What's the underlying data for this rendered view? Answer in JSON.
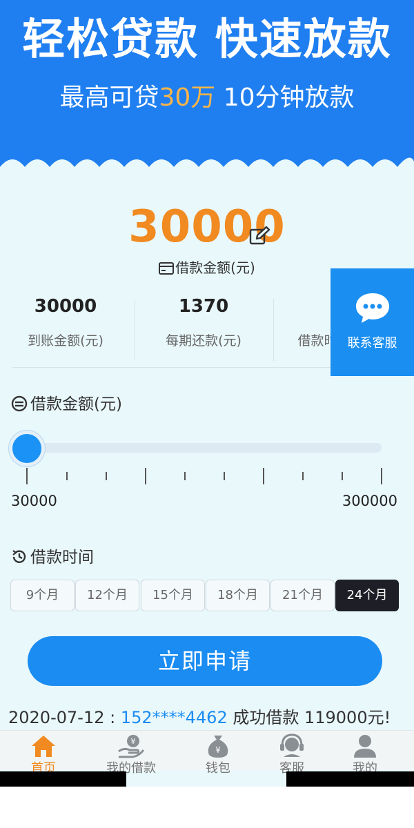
{
  "hero": {
    "title": "轻松贷款 快速放款",
    "sub_prefix": "最高可贷",
    "sub_highlight": "30万",
    "sub_suffix": " 10分钟放款",
    "bg_color": "#1f7ff0",
    "highlight_color": "#ffb547"
  },
  "amount": {
    "value": "30000",
    "caption": "借款金额(元)"
  },
  "stats": [
    {
      "value": "30000",
      "label": "到账金额(元)"
    },
    {
      "value": "1370",
      "label": "每期还款(元)"
    },
    {
      "value": "",
      "label": "借款时"
    }
  ],
  "service": {
    "label": "联系客服"
  },
  "slider": {
    "title": "借款金额(元)",
    "min_label": "30000",
    "max_label": "300000",
    "value_fraction": 0
  },
  "term": {
    "title": "借款时间",
    "options": [
      "9个月",
      "12个月",
      "15个月",
      "18个月",
      "21个月",
      "24个月"
    ],
    "selected": "24个月"
  },
  "apply_button": {
    "label": "立即申请"
  },
  "ticker": {
    "date": "2020-07-12 : ",
    "phone": "152****4462",
    "text": " 成功借款 119000元!"
  },
  "tabs": [
    {
      "label": "首页",
      "icon": "home-icon"
    },
    {
      "label": "我的借款",
      "icon": "loan-hand-icon"
    },
    {
      "label": "钱包",
      "icon": "wallet-bag-icon"
    },
    {
      "label": "客服",
      "icon": "headset-icon"
    },
    {
      "label": "我的",
      "icon": "user-icon"
    }
  ],
  "colors": {
    "accent_orange": "#f08a21",
    "primary_blue": "#1a8cf2",
    "page_bg": "#e9f8fb"
  }
}
